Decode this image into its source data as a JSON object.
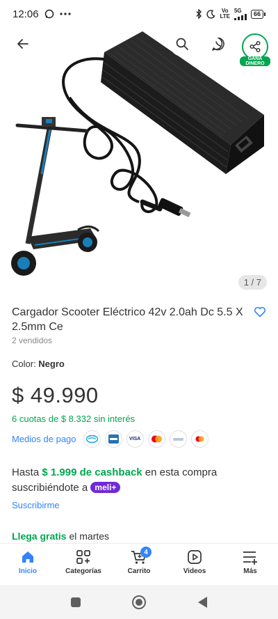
{
  "status": {
    "time": "12:06",
    "battery": "66",
    "network_top": "Vo",
    "network_bottom": "LTE",
    "signal_label": "5G"
  },
  "gallery": {
    "counter": "1 / 7",
    "share_badge_line1": "GANA",
    "share_badge_line2": "DINERO"
  },
  "product": {
    "title": "Cargador Scooter Eléctrico 42v 2.0ah Dc 5.5 X 2.5mm Ce",
    "sold": "2 vendidos",
    "color_label": "Color: ",
    "color_value": "Negro",
    "price": "$ 49.990",
    "installments": "6 cuotas de $ 8.332 sin interés",
    "payment_link": "Medios de pago",
    "payment_icons": [
      "mercadopago-icon",
      "amex-icon",
      "visa-icon",
      "mastercard-icon",
      "visa-debit-icon",
      "mastercard-debit-icon"
    ],
    "visa_text": "VISA",
    "cashback_prefix": "Hasta ",
    "cashback_amount": "$ 1.999 de cashback",
    "cashback_suffix": " en esta compra suscribiéndote a ",
    "meli_label": "meli+",
    "subscribe": "Suscribirme",
    "shipping_highlight": "Llega gratis",
    "shipping_rest": " el martes"
  },
  "nav": {
    "items": [
      {
        "label": "Inicio",
        "icon": "home-icon"
      },
      {
        "label": "Categorías",
        "icon": "categories-icon"
      },
      {
        "label": "Carrito",
        "icon": "cart-icon"
      },
      {
        "label": "Videos",
        "icon": "videos-icon"
      },
      {
        "label": "Más",
        "icon": "menu-plus-icon"
      }
    ],
    "cart_count": "4"
  },
  "colors": {
    "accent_blue": "#3483fa",
    "accent_green": "#00a650",
    "meli_purple": "#6f2ad8"
  }
}
